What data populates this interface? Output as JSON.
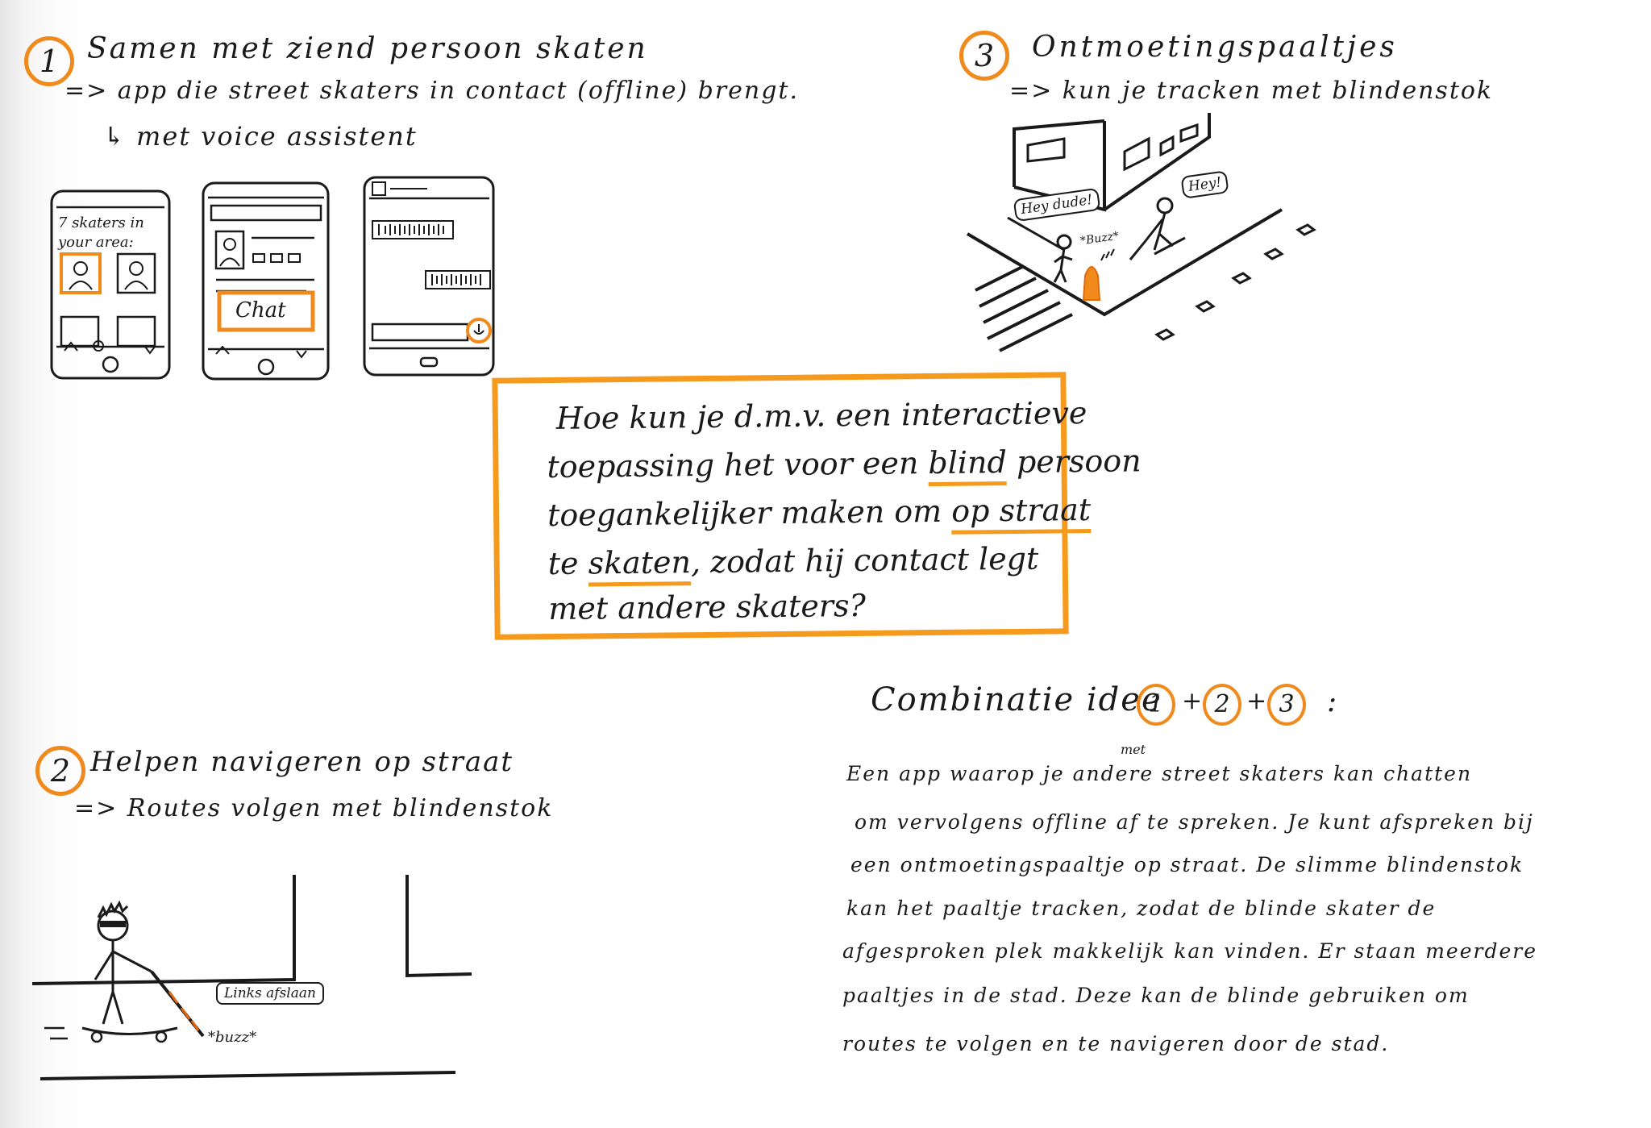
{
  "idea1": {
    "number": "1",
    "title": "Samen met ziend persoon skaten",
    "line2": "=> app die street skaters in contact (offline) brengt.",
    "line3": "↳ met voice assistent",
    "phone1_text_line1": "7 skaters in",
    "phone1_text_line2": "your area:",
    "phone2_button": "Chat"
  },
  "idea3": {
    "number": "3",
    "title": "Ontmoetingspaaltjes",
    "line2": "=> kun je tracken met blindenstok",
    "bubble_left": "Hey dude!",
    "bubble_right": "Hey!",
    "buzz": "*Buzz*"
  },
  "question": {
    "line1": "Hoe kun je d.m.v. een interactieve",
    "line2_a": "toepassing het voor een ",
    "line2_b": "blind",
    "line2_c": " persoon",
    "line3_a": "toegankelijker maken om ",
    "line3_b": "op straat",
    "line4_a": "te ",
    "line4_b": "skaten",
    "line4_c": ", zodat hij contact legt",
    "line5": "met andere skaters?"
  },
  "idea2": {
    "number": "2",
    "title": "Helpen navigeren op straat",
    "line2": "=> Routes volgen met blindenstok",
    "bubble": "Links afslaan",
    "buzz": "*buzz*"
  },
  "combination": {
    "title": "Combinatie idee",
    "n1": "1",
    "n2": "2",
    "n3": "3",
    "plus": "+",
    "colon": ":",
    "insert": "met",
    "lines": [
      "Een app waarop je andere street skaters kan chatten",
      "om vervolgens offline af te spreken. Je kunt afspreken bij",
      "een ontmoetingspaaltje op straat. De slimme blindenstok",
      "kan het paaltje tracken, zodat de blinde skater de",
      "afgesproken plek makkelijk kan vinden. Er staan meerdere",
      "paaltjes in de stad. Deze kan de blinde gebruiken om",
      "routes te volgen en te navigeren door de stad."
    ]
  },
  "colors": {
    "accent": "#f59a1c",
    "ink": "#1a1a1a",
    "paper": "#ffffff"
  }
}
